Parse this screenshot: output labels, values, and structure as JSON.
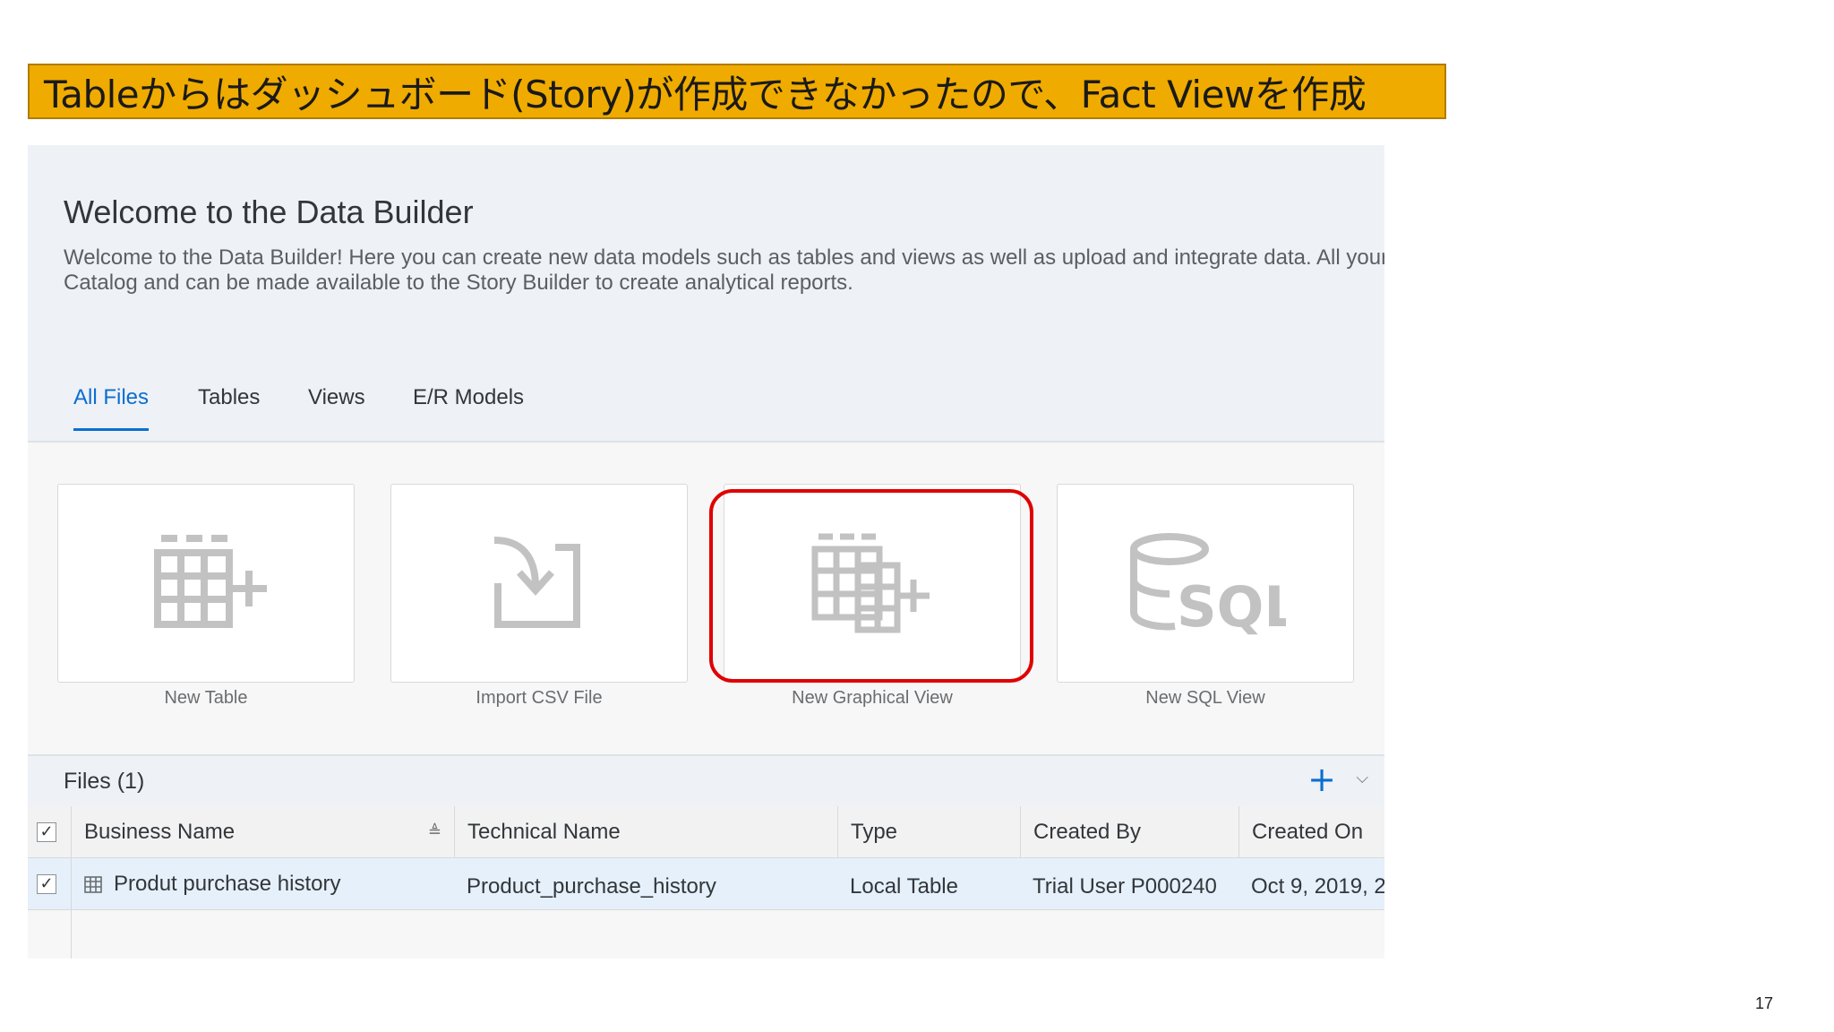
{
  "banner": {
    "text": "Tableからはダッシュボード(Story)が作成できなかったので、Fact Viewを作成"
  },
  "welcome": {
    "title": "Welcome to the Data Builder",
    "desc_line1": "Welcome to the Data Builder! Here you can create new data models such as tables and views as well as upload and integrate data. All your",
    "desc_line2": "Catalog and can be made available to the Story Builder to create analytical reports."
  },
  "tabs": [
    {
      "label": "All Files",
      "active": true
    },
    {
      "label": "Tables"
    },
    {
      "label": "Views"
    },
    {
      "label": "E/R Models"
    }
  ],
  "tiles": [
    {
      "label": "New Table",
      "icon": "table-plus-icon"
    },
    {
      "label": "Import CSV File",
      "icon": "import-icon"
    },
    {
      "label": "New Graphical View",
      "icon": "graphical-view-icon"
    },
    {
      "label": "New SQL View",
      "icon": "sql-icon"
    }
  ],
  "files": {
    "title": "Files (1)",
    "add_label": "+",
    "chevron": "⌵"
  },
  "table": {
    "columns": [
      "Business Name",
      "Technical Name",
      "Type",
      "Created By",
      "Created On"
    ],
    "rows": [
      {
        "business_name": "Produt purchase history",
        "technical_name": "Product_purchase_history",
        "type": "Local Table",
        "created_by": "Trial User P000240",
        "created_on": "Oct 9, 2019, 2:"
      }
    ]
  },
  "page": {
    "number": "17"
  },
  "colors": {
    "banner": "#f0ab00",
    "accent": "#0a6ed1",
    "highlight": "#e00000"
  }
}
